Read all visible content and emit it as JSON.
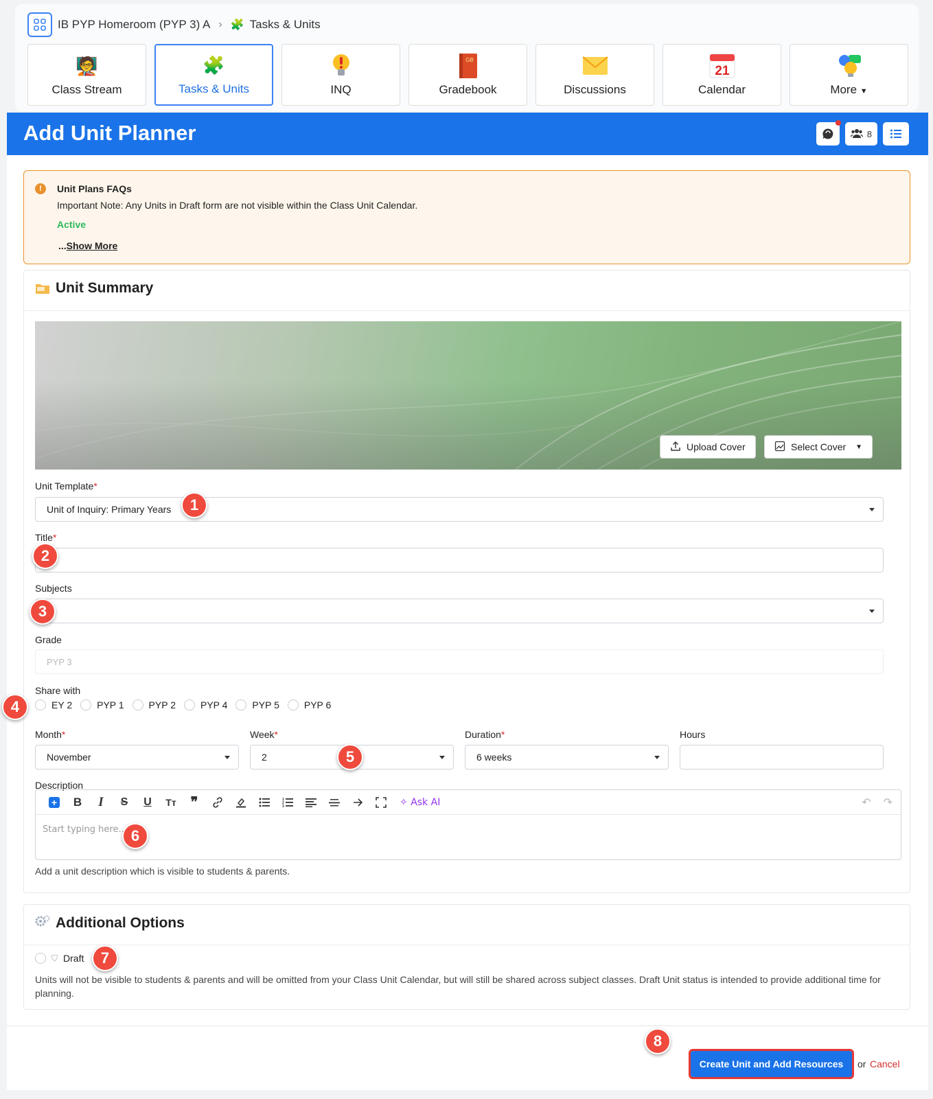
{
  "breadcrumb": {
    "class_name": "IB PYP Homeroom (PYP 3) A",
    "current": "Tasks & Units"
  },
  "tabs": [
    {
      "label": "Class Stream",
      "icon": "class-stream-icon"
    },
    {
      "label": "Tasks & Units",
      "icon": "puzzle-icon"
    },
    {
      "label": "INQ",
      "icon": "lightbulb-exclamation-icon"
    },
    {
      "label": "Gradebook",
      "icon": "gradebook-icon"
    },
    {
      "label": "Discussions",
      "icon": "envelope-icon"
    },
    {
      "label": "Calendar",
      "icon": "calendar-icon"
    },
    {
      "label": "More",
      "icon": "chat-bulb-icon"
    }
  ],
  "calendar_day": "21",
  "gradebook_abbr": "GB",
  "header": {
    "title": "Add Unit Planner",
    "members_count": "8"
  },
  "faq": {
    "title": "Unit Plans FAQs",
    "note": "Important Note: Any Units in Draft form are not visible within the Class Unit Calendar.",
    "status": "Active",
    "show_more_prefix": "...",
    "show_more": "Show More"
  },
  "summary": {
    "title": "Unit Summary",
    "upload_cover": "Upload Cover",
    "select_cover": "Select Cover",
    "template_label": "Unit Template",
    "template_value": "Unit of Inquiry: Primary Years",
    "title_label": "Title",
    "title_value": "",
    "subjects_label": "Subjects",
    "subjects_value": "",
    "grade_label": "Grade",
    "grade_value": "PYP 3",
    "share_label": "Share with",
    "share_options": [
      "EY 2",
      "PYP 1",
      "PYP 2",
      "PYP 4",
      "PYP 5",
      "PYP 6"
    ],
    "month_label": "Month",
    "month_value": "November",
    "week_label": "Week",
    "week_value": "2",
    "duration_label": "Duration",
    "duration_value": "6 weeks",
    "hours_label": "Hours",
    "hours_value": "",
    "description_label": "Description",
    "ask_ai": "Ask AI",
    "description_placeholder": "Start typing here...",
    "description_hint": "Add a unit description which is visible to students & parents."
  },
  "additional": {
    "title": "Additional Options",
    "draft_label": "Draft",
    "draft_hint": "Units will not be visible to students & parents and will be omitted from your Class Unit Calendar, but will still be shared across subject classes. Draft Unit status is intended to provide additional time for planning."
  },
  "footer": {
    "create": "Create Unit and Add Resources",
    "or": "or",
    "cancel": "Cancel"
  },
  "annotations": [
    "1",
    "2",
    "3",
    "4",
    "5",
    "6",
    "7",
    "8"
  ],
  "colors": {
    "primary": "#1a73e8",
    "warning": "#e8912d",
    "active": "#2eb85c",
    "danger": "#d32f2f",
    "annotation": "#ef4a3d"
  }
}
